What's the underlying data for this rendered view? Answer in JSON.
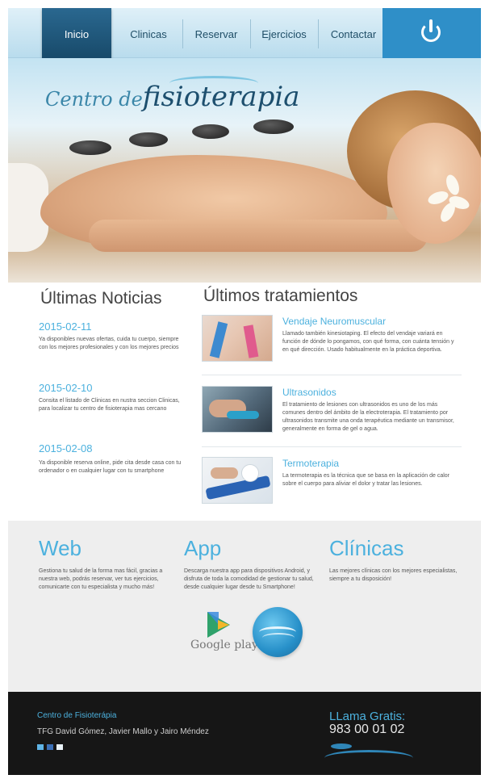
{
  "nav": {
    "items": [
      "Inicio",
      "Clinicas",
      "Reservar",
      "Ejercicios",
      "Contactar"
    ],
    "active_index": 0,
    "power_icon": "power-icon"
  },
  "hero": {
    "title_prefix": "Centro de",
    "title_main": "fisioterapia"
  },
  "news": {
    "heading": "Últimas Noticias",
    "items": [
      {
        "date": "2015-02-11",
        "text": "Ya disponibles nuevas ofertas, cuida tu cuerpo, siempre con los mejores profesionales y con los mejores precios"
      },
      {
        "date": "2015-02-10",
        "text": "Consita el listado de Clinicas en nustra seccion Clinicas, para localizar tu centro de fisioterapia mas cercano"
      },
      {
        "date": "2015-02-08",
        "text": "Ya disponible reserva online, pide cita desde casa con tu ordenador o en cualquier lugar con tu smartphone"
      }
    ]
  },
  "treatments": {
    "heading": "Últimos tratamientos",
    "items": [
      {
        "name": "Vendaje Neuromuscular",
        "text": "Llamado también kinesiotaping. El efecto del vendaje variará en función de dónde lo pongamos, con qué forma, con cuánta tensión y en qué dirección. Usado habitualmente en la práctica deportiva."
      },
      {
        "name": "Ultrasonidos",
        "text": "El tratamiento de lesiones con ultrasonidos es uno de los más comunes dentro del ámbito de la electroterapia. El tratamiento por ultrasonidos transmite una onda terapéutica mediante un transmisor, generalmente en forma de gel o agua."
      },
      {
        "name": "Termoterapia",
        "text": "La termoterapia es la técnica que se basa en la aplicación de calor sobre el cuerpo para aliviar el dolor y tratar las lesiones."
      }
    ]
  },
  "info": {
    "web": {
      "title": "Web",
      "text": "Gestiona tu salud de la forma mas fácil, gracias a nuestra web, podrás reservar, ver tus ejercicios, comunicarte con tu especialista y mucho más!"
    },
    "app": {
      "title": "App",
      "text": "Descarga nuestra app para dispositivos Android, y disfruta de toda la comodidad de gestionar tu salud, desde cualquier lugar desde tu Smartphone!",
      "store_label": "Google play"
    },
    "clinics": {
      "title": "Clínicas",
      "text": "Las mejores clínicas con los mejores especialistas, siempre a tu disposición!"
    }
  },
  "footer": {
    "brand": "Centro de Fisioterápia",
    "authors": "TFG David Gómez, Javier Mallo y Jairo Méndez",
    "call_label": "LLama Gratis:",
    "phone": "983 00 01 02"
  },
  "colors": {
    "accent": "#4cb1de",
    "nav_active": "#1f5a7e",
    "footer_bg": "#161616",
    "band_bg": "#eeeeee"
  }
}
